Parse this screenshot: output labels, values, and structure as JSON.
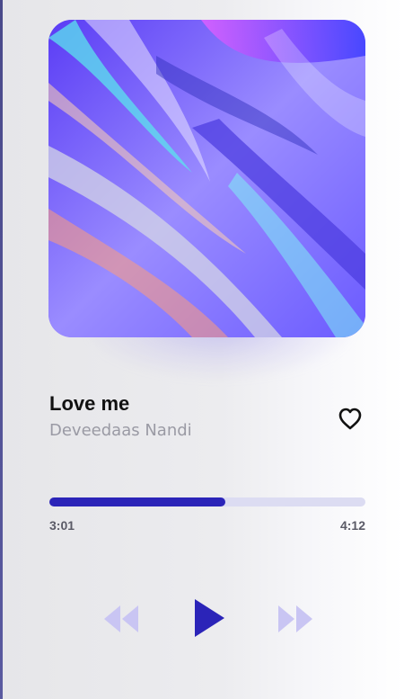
{
  "track": {
    "title": "Love me",
    "artist": "Deveedaas Nandi",
    "liked": false
  },
  "playback": {
    "current_time": "3:01",
    "total_time": "4:12",
    "progress": 0.556,
    "state": "paused"
  },
  "controls": {
    "previous_icon": "rewind-icon",
    "play_icon": "play-icon",
    "next_icon": "fast-forward-icon",
    "like_icon": "heart-outline-icon"
  },
  "colors": {
    "accent": "#2b24b8",
    "accent_light": "#c9c5f3",
    "track_bg": "#dcdcf2",
    "title_text": "#111111",
    "artist_text": "#9a9aa4",
    "time_text": "#5a5a66"
  }
}
